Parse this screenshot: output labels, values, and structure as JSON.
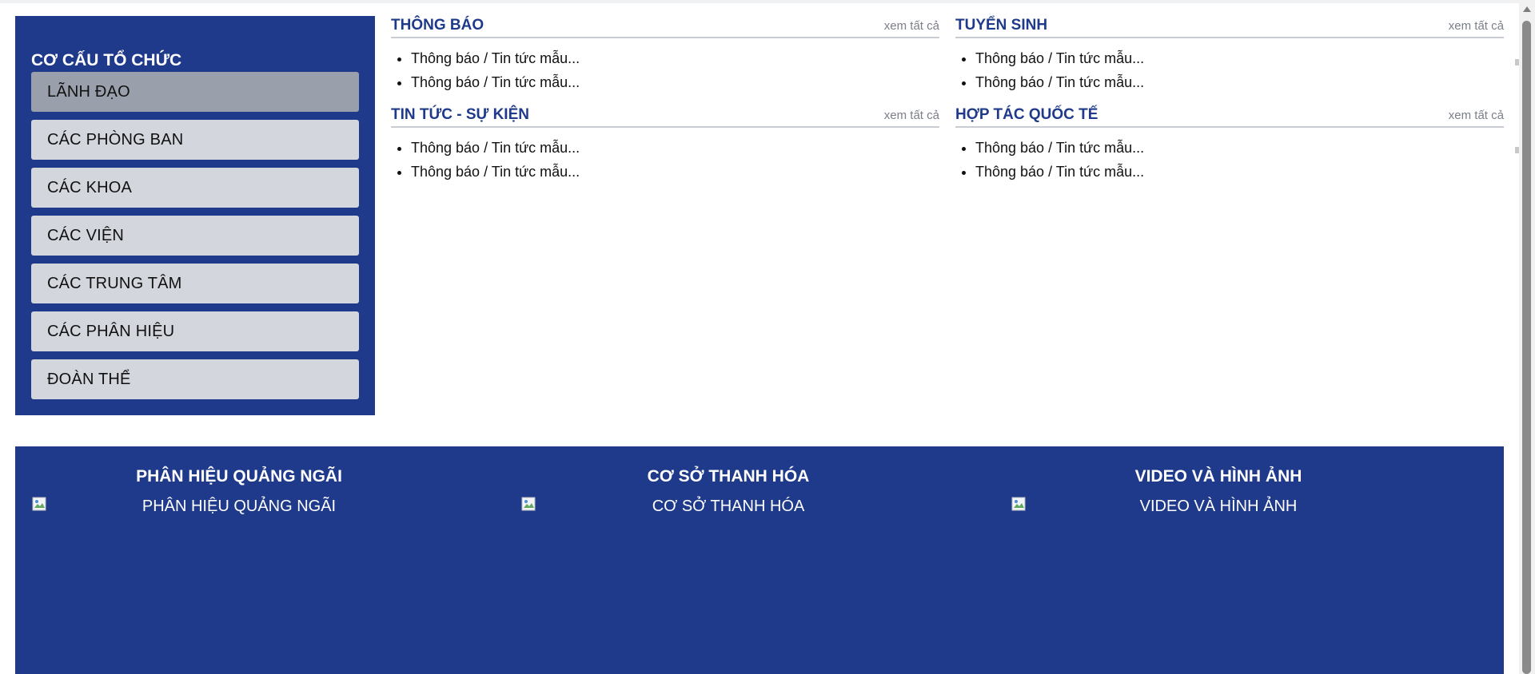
{
  "sidebar": {
    "title": "CƠ CẤU TỔ CHỨC",
    "items": [
      {
        "label": "LÃNH ĐẠO",
        "active": true
      },
      {
        "label": "CÁC PHÒNG BAN",
        "active": false
      },
      {
        "label": "CÁC KHOA",
        "active": false
      },
      {
        "label": "CÁC VIỆN",
        "active": false
      },
      {
        "label": "CÁC TRUNG TÂM",
        "active": false
      },
      {
        "label": "CÁC PHÂN HIỆU",
        "active": false
      },
      {
        "label": "ĐOÀN THỂ",
        "active": false
      }
    ]
  },
  "panels": [
    {
      "title": "THÔNG BÁO",
      "more": "xem tất cả",
      "items": [
        "Thông báo / Tin tức mẫu...",
        "Thông báo / Tin tức mẫu..."
      ]
    },
    {
      "title": "TUYỂN SINH",
      "more": "xem tất cả",
      "items": [
        "Thông báo / Tin tức mẫu...",
        "Thông báo / Tin tức mẫu..."
      ]
    },
    {
      "title": "TIN TỨC - SỰ KIỆN",
      "more": "xem tất cả",
      "items": [
        "Thông báo / Tin tức mẫu...",
        "Thông báo / Tin tức mẫu..."
      ]
    },
    {
      "title": "HỢP TÁC QUỐC TẾ",
      "more": "xem tất cả",
      "items": [
        "Thông báo / Tin tức mẫu...",
        "Thông báo / Tin tức mẫu..."
      ]
    }
  ],
  "footer": {
    "columns": [
      {
        "title": "PHÂN HIỆU QUẢNG NGÃI",
        "image_alt": "PHÂN HIỆU QUẢNG NGÃI"
      },
      {
        "title": "CƠ SỞ THANH HÓA",
        "image_alt": "CƠ SỞ THANH HÓA"
      },
      {
        "title": "VIDEO VÀ HÌNH ẢNH",
        "image_alt": "VIDEO VÀ HÌNH ẢNH"
      }
    ]
  },
  "colors": {
    "brand_blue": "#1f3a8a",
    "item_bg": "#d4d6dd",
    "item_active_bg": "#9aa0ab",
    "muted_text": "#7a7f88"
  },
  "icons": {
    "broken_image": "broken-image-icon",
    "scroll_up": "chevron-up-icon"
  }
}
